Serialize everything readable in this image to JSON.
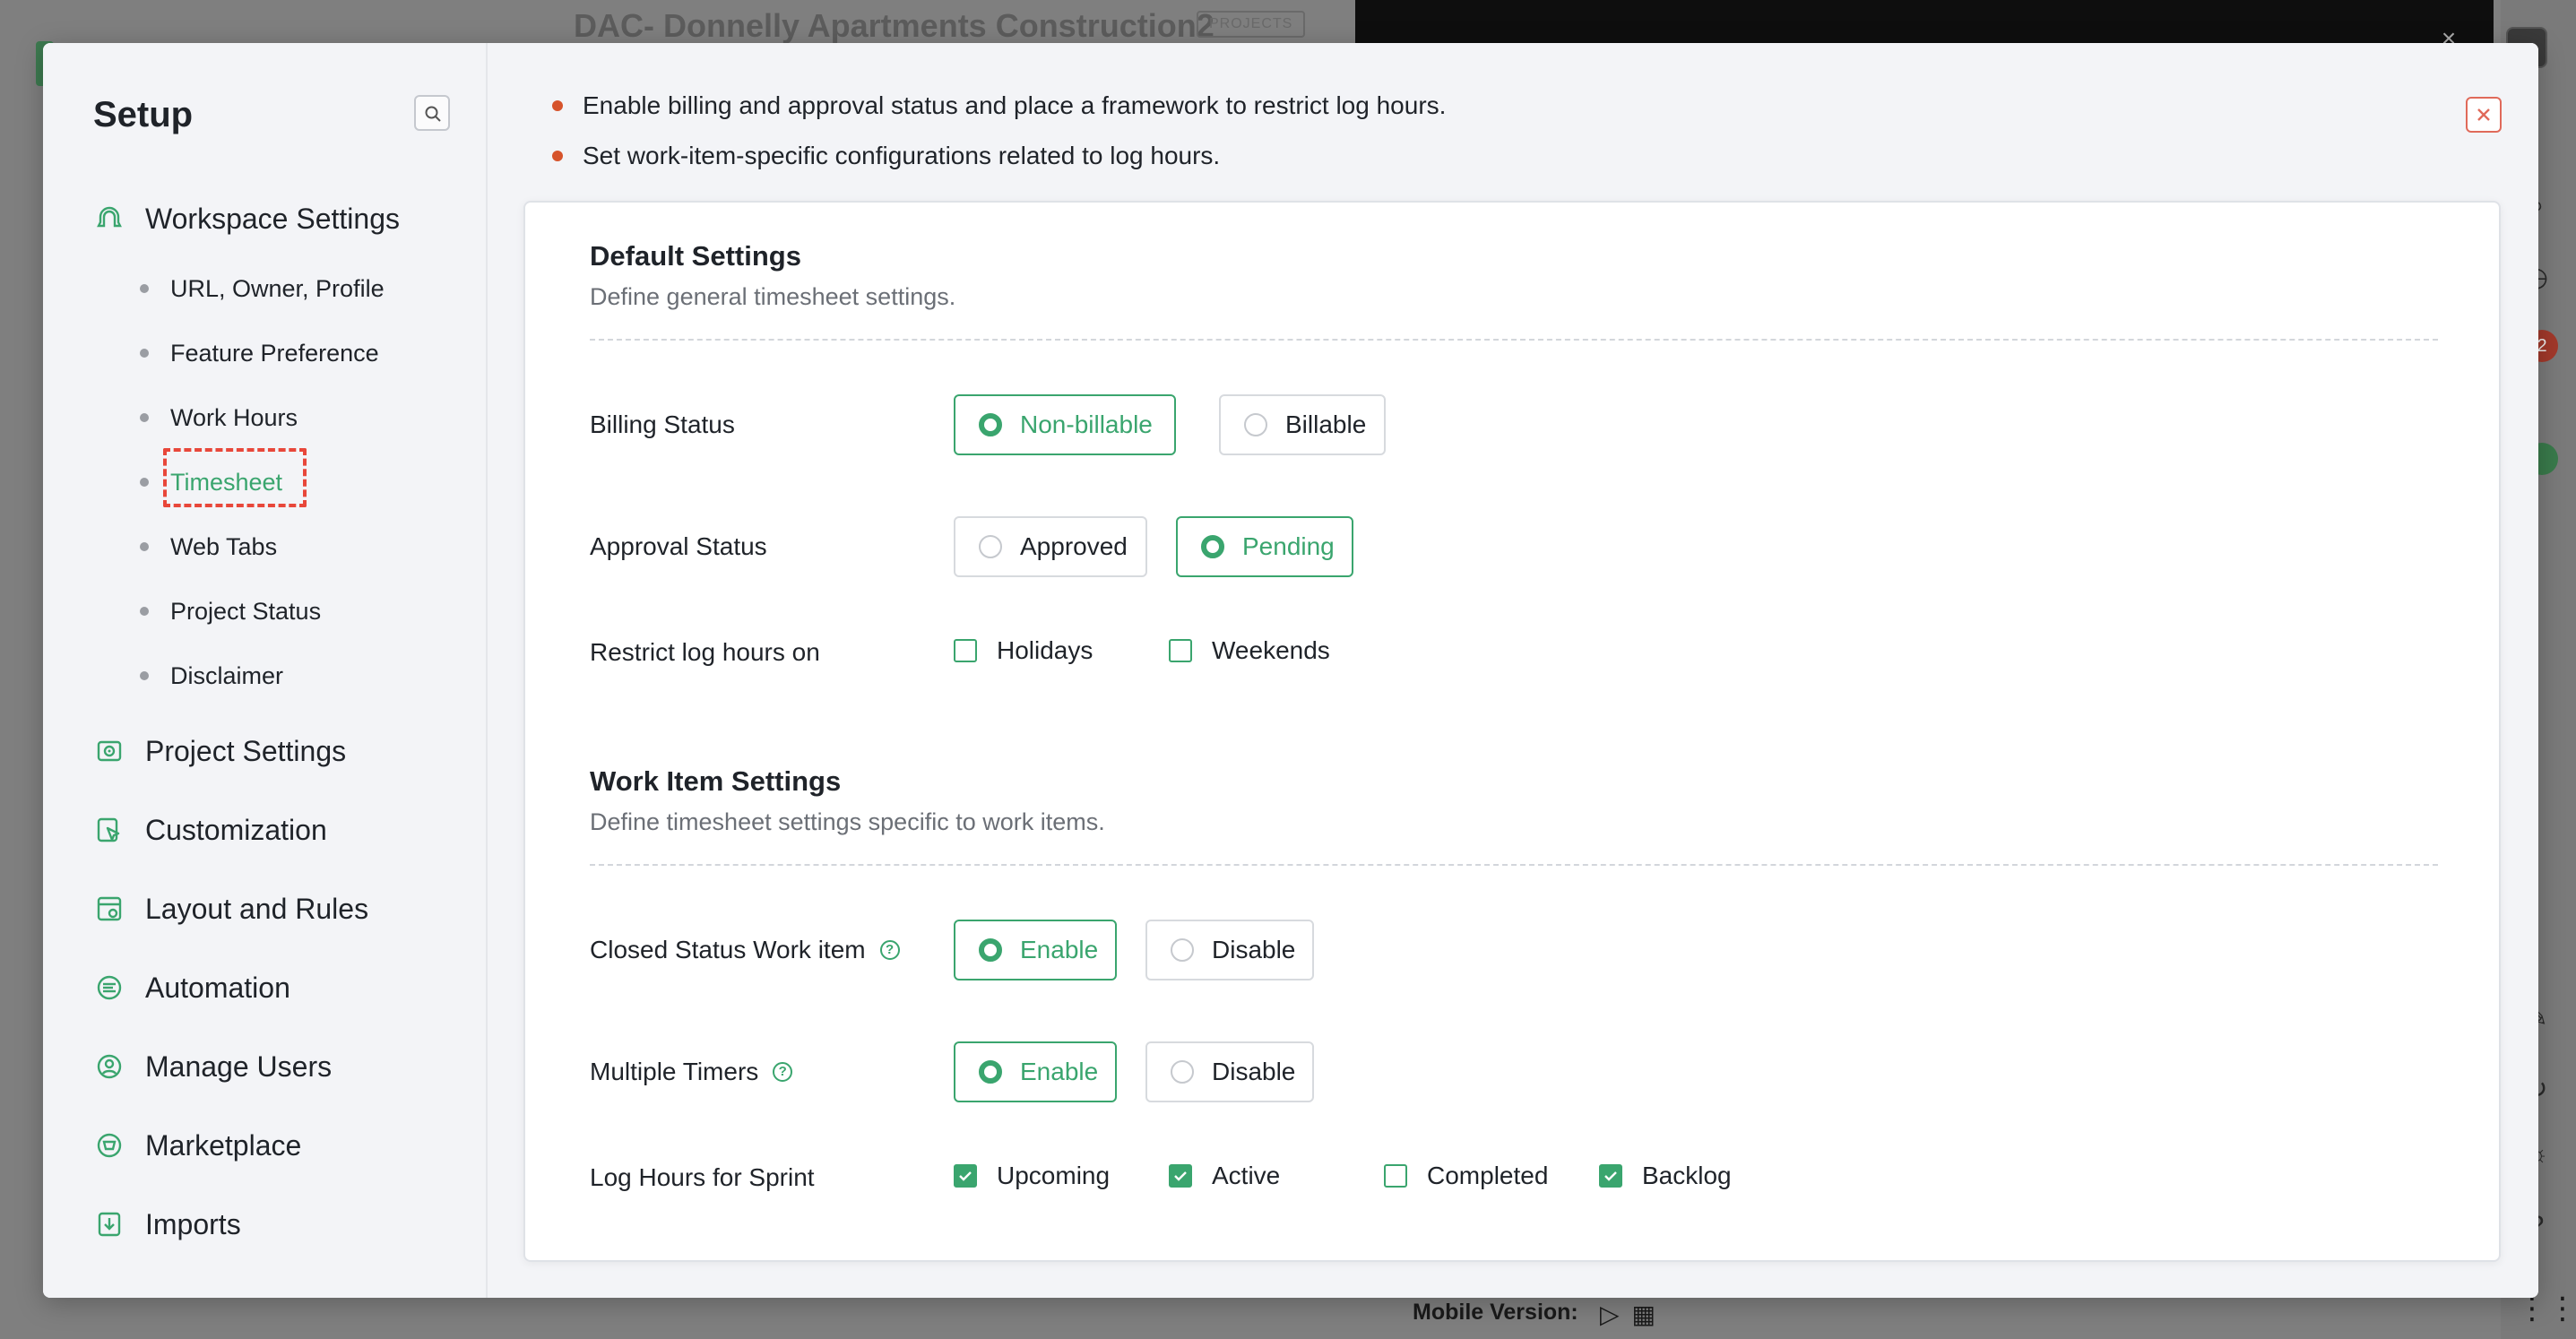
{
  "background": {
    "project_title": "DAC- Donnelly Apartments Construction2",
    "project_badge": "PROJECTS",
    "notification_count": "2",
    "mobile_version_label": "Mobile Version:"
  },
  "sidebar": {
    "title": "Setup",
    "sections": [
      {
        "label": "Workspace Settings",
        "icon": "workspace-icon"
      },
      {
        "label": "Project Settings",
        "icon": "project-icon"
      },
      {
        "label": "Customization",
        "icon": "customization-icon"
      },
      {
        "label": "Layout and Rules",
        "icon": "layout-icon"
      },
      {
        "label": "Automation",
        "icon": "automation-icon"
      },
      {
        "label": "Manage Users",
        "icon": "users-icon"
      },
      {
        "label": "Marketplace",
        "icon": "marketplace-icon"
      },
      {
        "label": "Imports",
        "icon": "imports-icon"
      }
    ],
    "workspace_items": [
      {
        "label": "URL, Owner, Profile"
      },
      {
        "label": "Feature Preference"
      },
      {
        "label": "Work Hours"
      },
      {
        "label": "Timesheet",
        "active": true
      },
      {
        "label": "Web Tabs"
      },
      {
        "label": "Project Status"
      },
      {
        "label": "Disclaimer"
      }
    ]
  },
  "intro": {
    "bullets": [
      "Enable billing and approval status and place a framework to restrict log hours.",
      "Set work-item-specific configurations related to log hours."
    ]
  },
  "default_settings": {
    "title": "Default Settings",
    "description": "Define general timesheet settings.",
    "billing_status": {
      "label": "Billing Status",
      "options": [
        "Non-billable",
        "Billable"
      ],
      "selected": "Non-billable"
    },
    "approval_status": {
      "label": "Approval Status",
      "options": [
        "Approved",
        "Pending"
      ],
      "selected": "Pending"
    },
    "restrict_log_hours": {
      "label": "Restrict log hours on",
      "options": [
        {
          "label": "Holidays",
          "checked": false
        },
        {
          "label": "Weekends",
          "checked": false
        }
      ]
    }
  },
  "work_item_settings": {
    "title": "Work Item Settings",
    "description": "Define timesheet settings specific to work items.",
    "closed_status": {
      "label": "Closed Status Work item",
      "options": [
        "Enable",
        "Disable"
      ],
      "selected": "Enable"
    },
    "multiple_timers": {
      "label": "Multiple Timers",
      "options": [
        "Enable",
        "Disable"
      ],
      "selected": "Enable"
    },
    "log_hours_sprint": {
      "label": "Log Hours for Sprint",
      "options": [
        {
          "label": "Upcoming",
          "checked": true
        },
        {
          "label": "Active",
          "checked": true
        },
        {
          "label": "Completed",
          "checked": false
        },
        {
          "label": "Backlog",
          "checked": true
        }
      ]
    }
  },
  "colors": {
    "accent": "#3aa56e",
    "bullet": "#d6532b",
    "highlight": "#e8473a"
  }
}
